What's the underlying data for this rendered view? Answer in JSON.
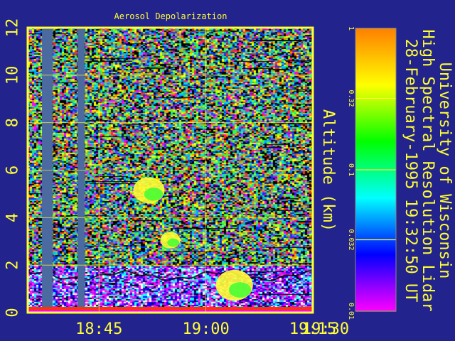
{
  "chart_data": {
    "type": "heatmap",
    "title": "Aerosol Depolarization",
    "xlabel": "",
    "ylabel": "Altitude (km)",
    "x_tick_labels": [
      "18:45",
      "19:00",
      "19:15",
      "19:30"
    ],
    "y_ticks": [
      0,
      2,
      4,
      6,
      8,
      10,
      12
    ],
    "ylim": [
      0,
      12
    ],
    "x_range_minutes": [
      755,
      795
    ],
    "x_tick_minutes": [
      765,
      780,
      795,
      810
    ],
    "colorbar": {
      "scale": "log",
      "range": [
        0.01,
        1
      ],
      "tick_values": [
        1,
        0.32,
        0.1,
        0.032,
        0.01
      ],
      "tick_labels": [
        "1",
        "0.32",
        "0.1",
        "0.032",
        "0.01"
      ],
      "colors": [
        "#ff7f00",
        "#ffff00",
        "#00ff00",
        "#00ffff",
        "#0000ff",
        "#ff00ff"
      ]
    },
    "grid": true,
    "data_gaps_minutes": [
      [
        757,
        758.5
      ],
      [
        762,
        763
      ]
    ],
    "features": [
      {
        "kind": "boundary-layer-aerosol",
        "alt_km": [
          0,
          2
        ]
      },
      {
        "kind": "aerosol-patch",
        "time_min": 784,
        "alt_km": [
          0.5,
          1.8
        ]
      },
      {
        "kind": "aerosol-patch",
        "time_min": 775,
        "alt_km": [
          2.7,
          3.4
        ]
      },
      {
        "kind": "aerosol-patch",
        "time_min": 772,
        "alt_km": [
          4.6,
          5.7
        ]
      }
    ]
  },
  "side_text": {
    "line1": "University of Wisconsin",
    "line2": "High Spectral Resolution Lidar",
    "line3": "28-February-1995 19:32:50 UT"
  },
  "colors": {
    "background": "#23238e",
    "text": "#ffff33",
    "frame": "#ffff33"
  }
}
